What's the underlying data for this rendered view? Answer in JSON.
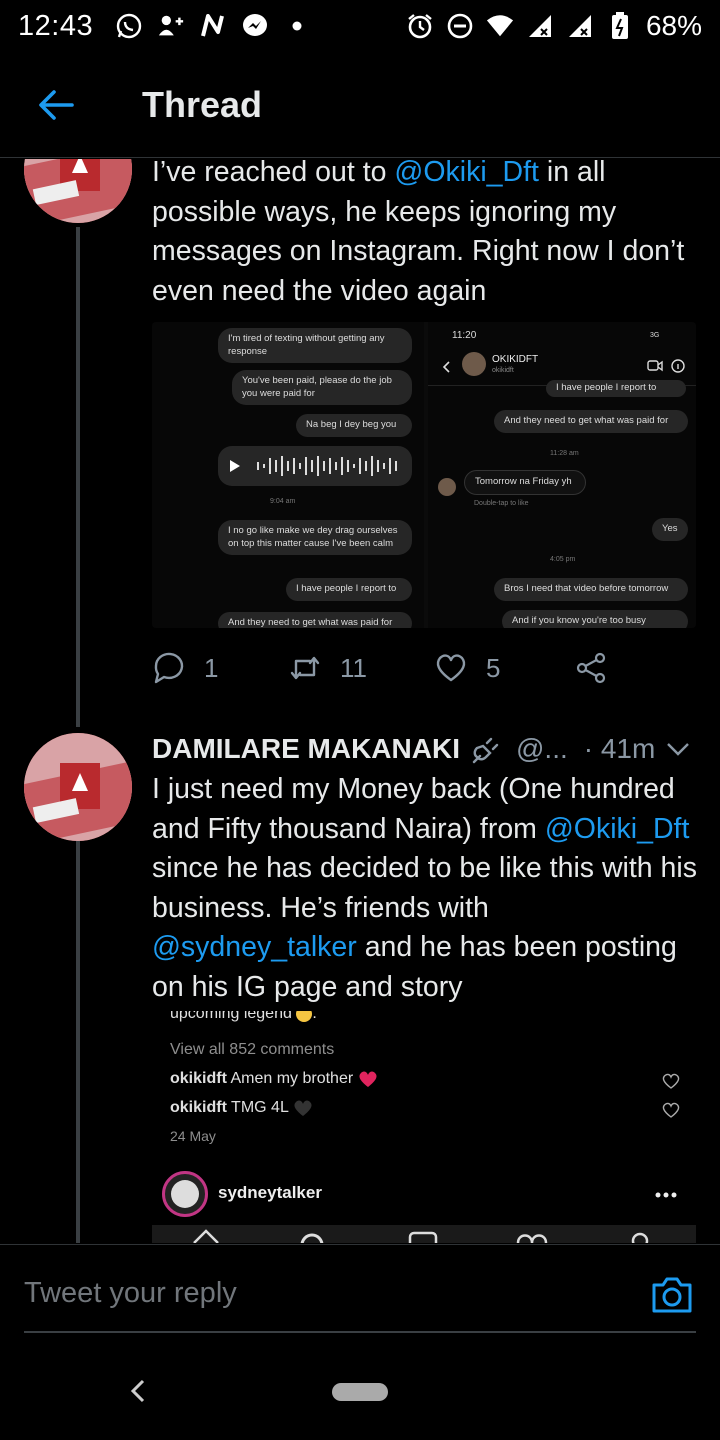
{
  "status_bar": {
    "time": "12:43",
    "battery": "68%",
    "left_icons": [
      "whatsapp-icon",
      "add-user-icon",
      "n-app-icon",
      "messenger-icon",
      "dot-icon"
    ],
    "right_icons": [
      "alarm-icon",
      "dnd-icon",
      "wifi-icon",
      "signal-icon",
      "signal-icon",
      "battery-icon"
    ]
  },
  "header": {
    "title": "Thread"
  },
  "tweet1": {
    "text_parts": {
      "p1": "I’ve reached out to ",
      "mention1": "@Okiki_Dft",
      "p2": " in all possible ways, he keeps ignoring my messages on Instagram. Right now I don’t even need the video again"
    },
    "media_left": {
      "bubbles": [
        "I'm tired of texting without getting any response",
        "You've been paid, please do the job you were paid for",
        "Na beg I dey beg you",
        "I no go like make we dey drag ourselves on top this matter cause I've been calm",
        "I have people I report to",
        "And they need to get what was paid for"
      ],
      "timestamp": "9:04 am"
    },
    "media_right": {
      "time": "11:20",
      "network": "3G",
      "username": "OKIKIDFT",
      "subname": "okikidft",
      "bubbles": [
        "I have people I report to",
        "And they need to get what was paid for",
        "Tomorrow na Friday yh",
        "Yes",
        "Bros I need that video before tomorrow",
        "And if you know you're too busy"
      ],
      "timestamps": [
        "11:28 am",
        "4:05 pm"
      ],
      "hint": "Double-tap to like"
    },
    "actions": {
      "replies": "1",
      "retweets": "11",
      "likes": "5"
    }
  },
  "tweet2": {
    "name": "DAMILARE MAKANAKI",
    "handle": "@...",
    "time": "· 41m",
    "text_parts": {
      "p1": "I just need my Money back (One hundred and Fifty thousand Naira) from ",
      "mention1": "@Okiki_Dft",
      "p2": " since he has decided to be like this with his business. He’s friends with ",
      "mention2": "@sydney_talker",
      "p3": " and he has been posting on his IG page and story"
    },
    "ig_screenshot": {
      "caption_tail": "upcoming legend",
      "view_comments": "View all 852 comments",
      "comments": [
        {
          "user": "okikidft",
          "text": "Amen my brother"
        },
        {
          "user": "okikidft",
          "text": "TMG 4L"
        }
      ],
      "date": "24 May",
      "post_user": "sydneytalker"
    }
  },
  "reply_bar": {
    "placeholder": "Tweet your reply"
  },
  "colors": {
    "accent": "#1d9bf0",
    "background": "#000000",
    "text": "#e7e9ea",
    "muted": "#8b98a5"
  }
}
